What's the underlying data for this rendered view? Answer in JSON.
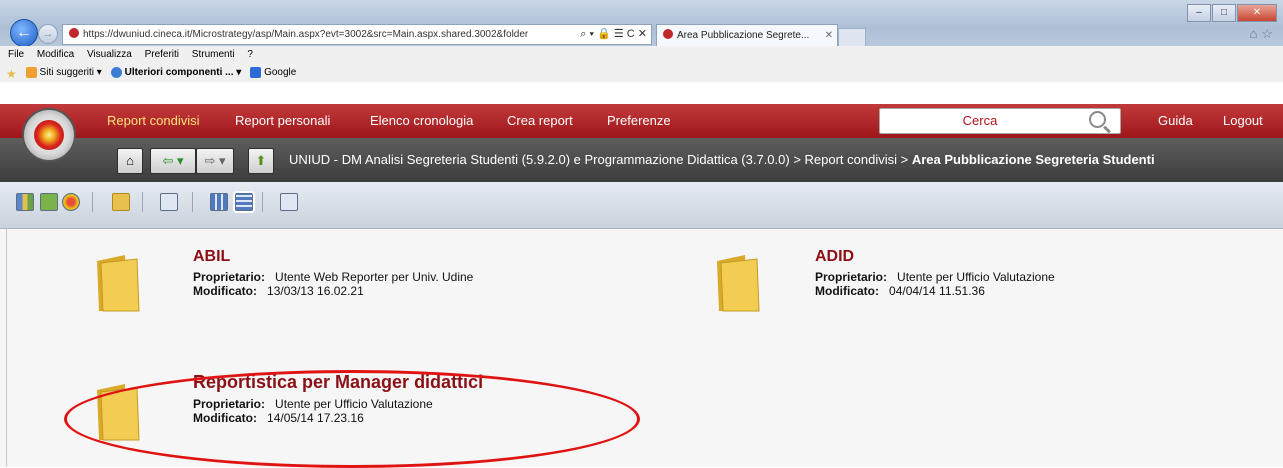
{
  "browser": {
    "address": "https://dwuniud.cineca.it/Microstrategy/asp/Main.aspx?evt=3002&src=Main.aspx.shared.3002&folder",
    "address_controls": "⌕ ▾ 🔒 ☰ C ✕",
    "tab_title": "Area Pubblicazione Segrete...",
    "tab_close": "✕",
    "window_controls": {
      "minimize": "–",
      "maximize": "□",
      "close": "✕"
    },
    "menu": [
      "File",
      "Modifica",
      "Visualizza",
      "Preferiti",
      "Strumenti",
      "?"
    ],
    "favorites": [
      {
        "label": "Siti suggeriti ▾",
        "color": "#f0a030"
      },
      {
        "label": "Ulteriori componenti ... ▾",
        "color": "#3b7fd4"
      },
      {
        "label": "Google",
        "color": "#2f6ad9"
      }
    ]
  },
  "app": {
    "nav": [
      "Report condivisi",
      "Report personali",
      "Elenco cronologia",
      "Crea report",
      "Preferenze"
    ],
    "search_placeholder": "Cerca",
    "help": "Guida",
    "logout": "Logout",
    "crumb_buttons": {
      "home": "⌂",
      "back": "⇦ ▾",
      "forward": "⇨ ▾",
      "up": "⬆"
    },
    "breadcrumb": {
      "path": "UNIUD - DM Analisi Segreteria Studenti (5.9.2.0) e Programmazione Didattica (3.7.0.0) > Report condivisi > ",
      "current": "Area Pubblicazione Segreteria Studenti"
    },
    "accent": "#a3181c"
  },
  "folders": [
    {
      "title": "ABIL",
      "owner_label": "Proprietario:",
      "owner": "Utente Web Reporter per Univ. Udine",
      "modified_label": "Modificato:",
      "modified": "13/03/13 16.02.21"
    },
    {
      "title": "ADID",
      "owner_label": "Proprietario:",
      "owner": "Utente per Ufficio Valutazione",
      "modified_label": "Modificato:",
      "modified": "04/04/14 11.51.36"
    },
    {
      "title": "Reportistica per Manager didattici",
      "owner_label": "Proprietario:",
      "owner": "Utente per Ufficio Valutazione",
      "modified_label": "Modificato:",
      "modified": "14/05/14 17.23.16"
    }
  ]
}
